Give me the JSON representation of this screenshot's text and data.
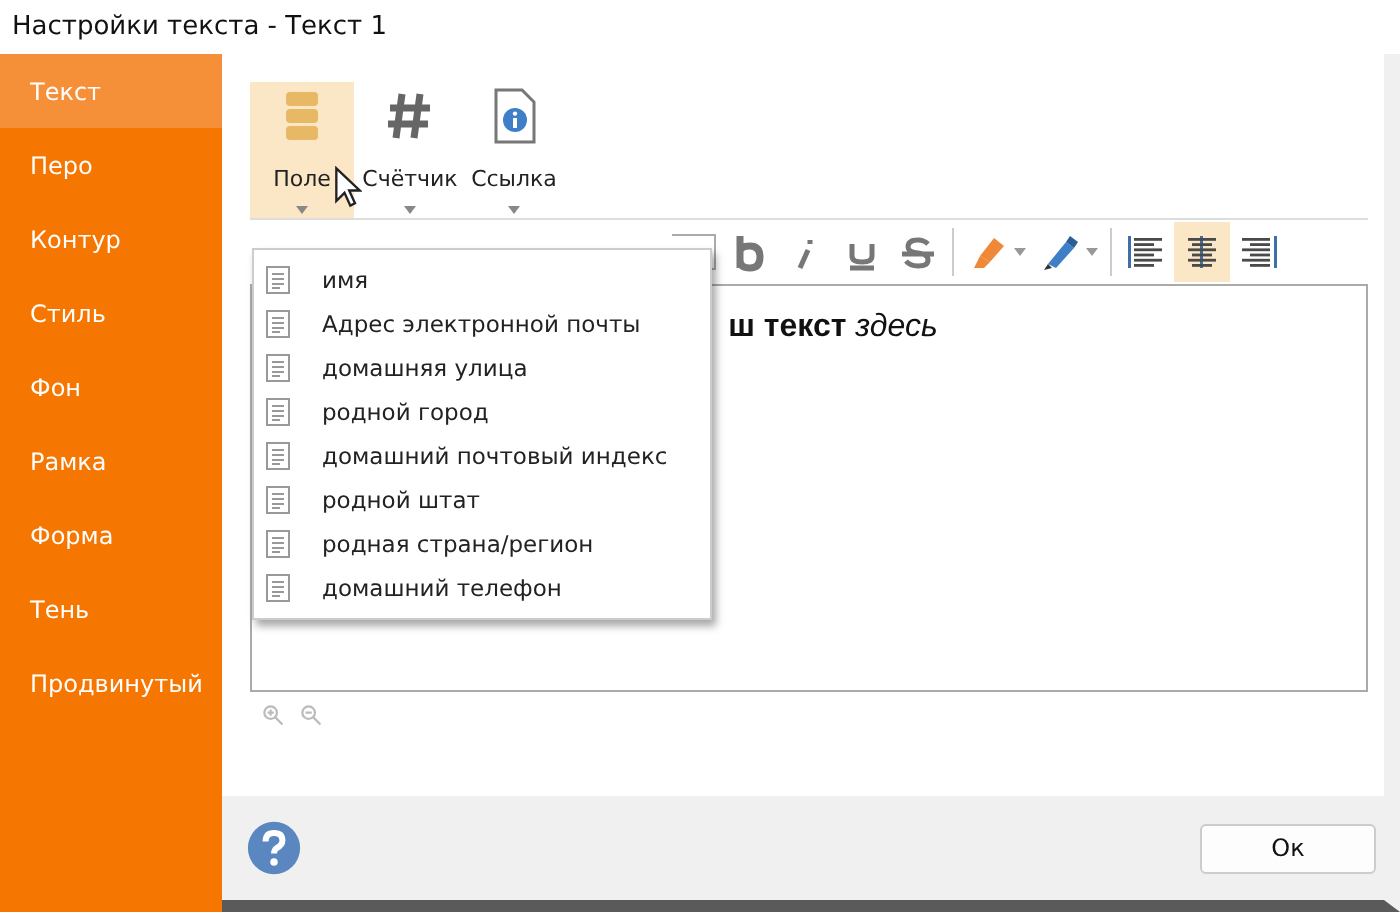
{
  "window": {
    "title": "Настройки текста - Текст 1"
  },
  "sidebar": {
    "items": [
      {
        "label": "Текст",
        "selected": true
      },
      {
        "label": "Перо",
        "selected": false
      },
      {
        "label": "Контур",
        "selected": false
      },
      {
        "label": "Стиль",
        "selected": false
      },
      {
        "label": "Фон",
        "selected": false
      },
      {
        "label": "Рамка",
        "selected": false
      },
      {
        "label": "Форма",
        "selected": false
      },
      {
        "label": "Тень",
        "selected": false
      },
      {
        "label": "Продвинутый",
        "selected": false
      }
    ]
  },
  "ribbon": [
    {
      "kind": "field",
      "label": "Поле",
      "selected": true
    },
    {
      "kind": "counter",
      "label": "Счётчик",
      "selected": false
    },
    {
      "kind": "link",
      "label": "Ссылка",
      "selected": false
    }
  ],
  "format_toolbar": {
    "align": [
      {
        "kind": "left",
        "selected": false
      },
      {
        "kind": "center",
        "selected": true
      },
      {
        "kind": "right",
        "selected": false
      }
    ]
  },
  "editor": {
    "text": "**ш текст** *здесь*"
  },
  "field_menu": {
    "items": [
      "имя",
      "Адрес электронной почты",
      "домашняя улица",
      "родной город",
      "домашний почтовый индекс",
      "родной штат",
      "родная страна/регион",
      "домашний телефон"
    ]
  },
  "footer": {
    "ok": "Ок"
  }
}
